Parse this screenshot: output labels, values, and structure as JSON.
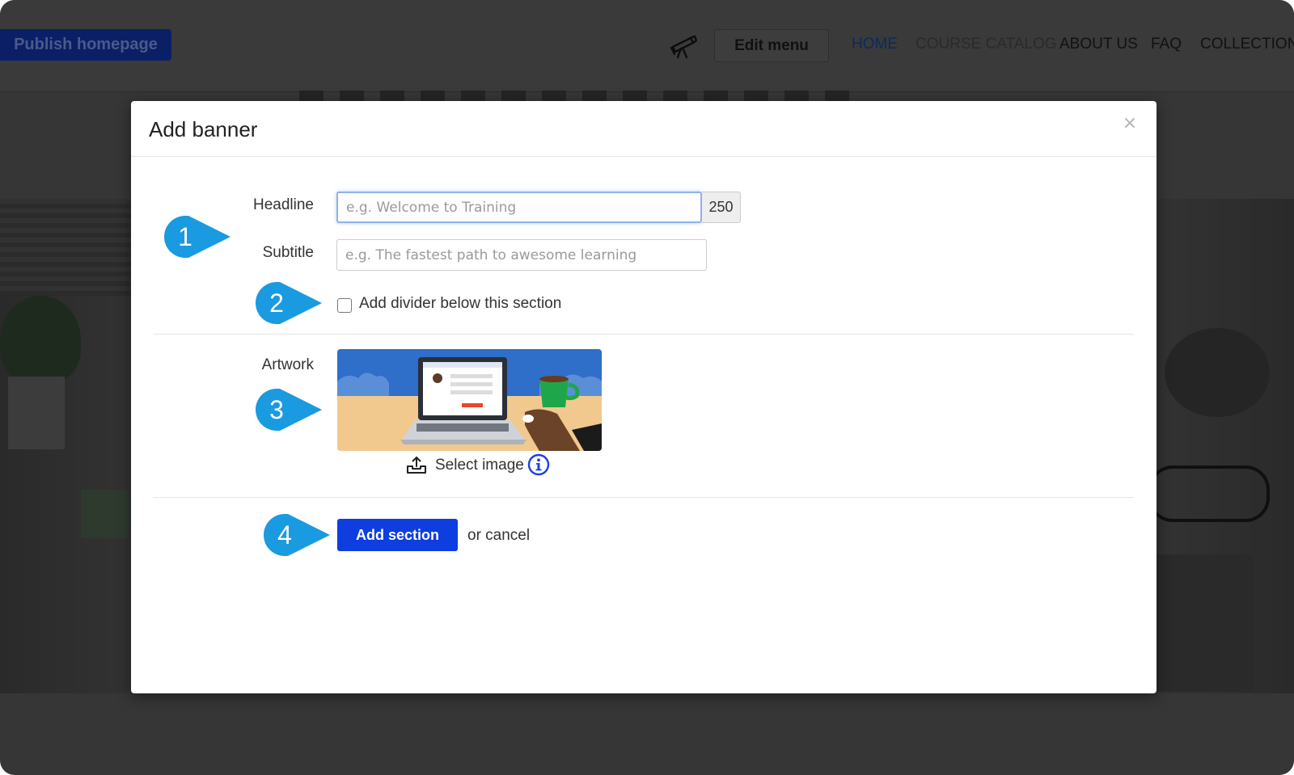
{
  "background": {
    "publish_button": "Publish homepage",
    "edit_menu_button": "Edit menu",
    "nav": [
      {
        "label": "HOME"
      },
      {
        "label": "COURSE CATALOG"
      },
      {
        "label": "ABOUT US"
      },
      {
        "label": "FAQ"
      },
      {
        "label": "COLLECTION"
      }
    ]
  },
  "modal": {
    "title": "Add banner",
    "close_symbol": "×",
    "headline": {
      "label": "Headline",
      "value": "",
      "placeholder": "e.g. Welcome to Training",
      "char_count": "250"
    },
    "subtitle": {
      "label": "Subtitle",
      "value": "",
      "placeholder": "e.g. The fastest path to awesome learning"
    },
    "divider_option": {
      "label": "Add divider below this section",
      "checked": false
    },
    "artwork": {
      "label": "Artwork",
      "select_label": "Select image"
    },
    "actions": {
      "primary": "Add section",
      "cancel": "or cancel"
    }
  },
  "markers": [
    "1",
    "2",
    "3",
    "4"
  ],
  "colors": {
    "marker": "#1a9ae0",
    "primary_button": "#0e3ee0",
    "overlay_page": "#363636",
    "focus_border": "#8db3ea"
  },
  "icons": {
    "telescope": "telescope-icon",
    "close": "close-icon",
    "upload": "upload-icon",
    "info": "info-icon"
  }
}
